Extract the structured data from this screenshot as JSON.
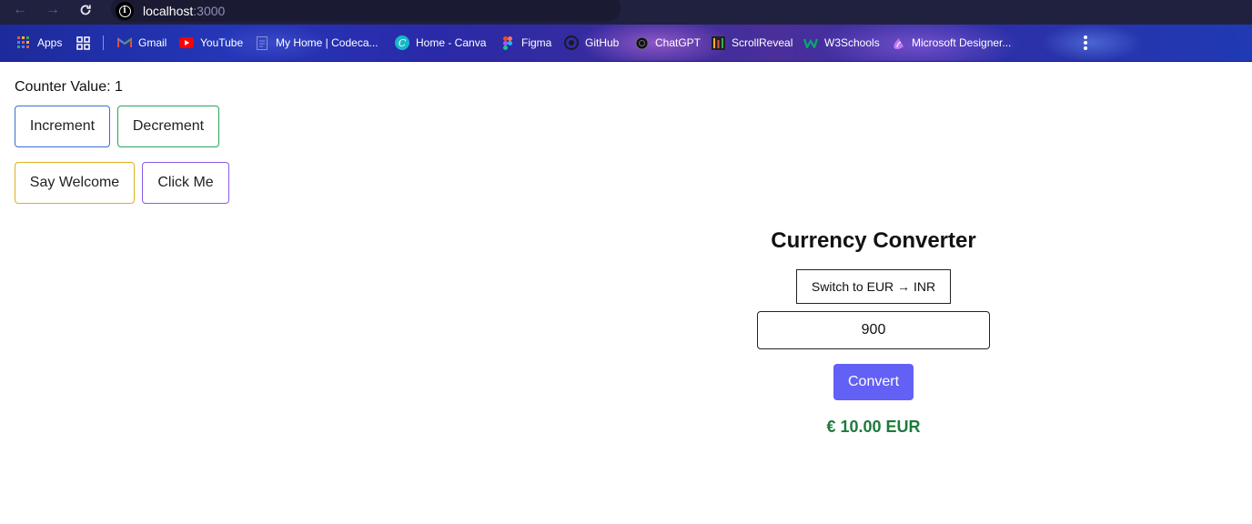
{
  "browser": {
    "url_host": "localhost",
    "url_port": ":3000",
    "bookmarks": [
      {
        "label": "Apps",
        "icon": "apps-grid-icon"
      },
      {
        "label": "Gmail",
        "icon": "gmail-icon"
      },
      {
        "label": "YouTube",
        "icon": "youtube-icon"
      },
      {
        "label": "My Home | Codeca...",
        "icon": "codecademy-icon"
      },
      {
        "label": "Home - Canva",
        "icon": "canva-icon"
      },
      {
        "label": "Figma",
        "icon": "figma-icon"
      },
      {
        "label": "GitHub",
        "icon": "github-icon"
      },
      {
        "label": "ChatGPT",
        "icon": "chatgpt-icon"
      },
      {
        "label": "ScrollReveal",
        "icon": "scrollreveal-icon"
      },
      {
        "label": "W3Schools",
        "icon": "w3schools-icon"
      },
      {
        "label": "Microsoft Designer...",
        "icon": "microsoft-designer-icon"
      }
    ]
  },
  "counter": {
    "label": "Counter Value: 1",
    "increment_label": "Increment",
    "decrement_label": "Decrement"
  },
  "actions": {
    "welcome_label": "Say Welcome",
    "click_label": "Click Me"
  },
  "converter": {
    "title": "Currency Converter",
    "switch_label": "Switch to EUR → INR",
    "amount_value": "900",
    "convert_label": "Convert",
    "result": "€ 10.00 EUR"
  },
  "colors": {
    "convert_button": "#6360f5",
    "result_text": "#1e7a3c",
    "increment_border": "#3a6fd0",
    "decrement_border": "#28a55a",
    "welcome_border": "#e0b020",
    "click_border": "#8a5ae8"
  }
}
